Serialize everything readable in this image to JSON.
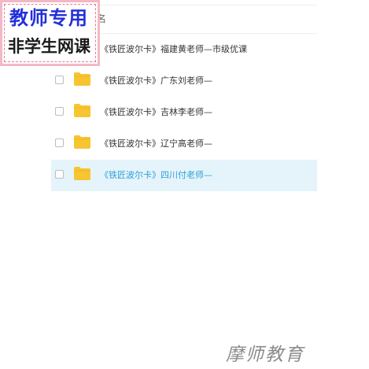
{
  "stamp": {
    "line1": "教师专用",
    "line2": "非学生网课"
  },
  "list": {
    "header_name": "名",
    "rows": [
      {
        "name": "《铁匠波尔卡》福建黄老师—市级优课",
        "selected": false
      },
      {
        "name": "《铁匠波尔卡》广东刘老师—",
        "selected": false
      },
      {
        "name": "《铁匠波尔卡》吉林李老师—",
        "selected": false
      },
      {
        "name": "《铁匠波尔卡》辽宁高老师—",
        "selected": false
      },
      {
        "name": "《铁匠波尔卡》四川付老师—",
        "selected": true
      }
    ]
  },
  "watermark": "摩师教育",
  "colors": {
    "folder": "#f7c531",
    "selected_row_bg": "#e5f4fb",
    "selected_text": "#2f9fd8"
  }
}
